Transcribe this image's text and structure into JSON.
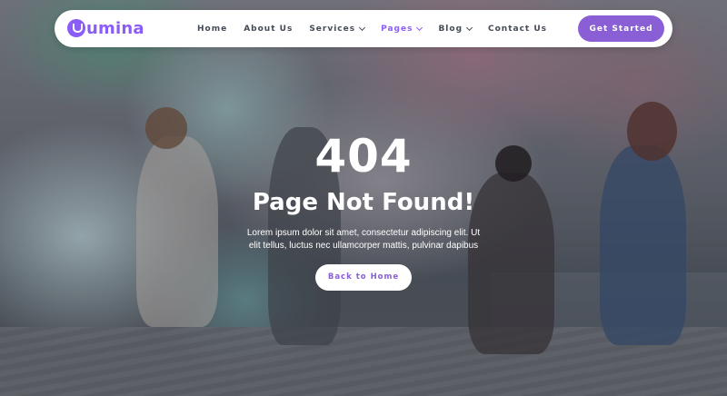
{
  "brand": {
    "name": "umina",
    "logo_letter": "L",
    "color": "#8b5cf6"
  },
  "nav": {
    "items": [
      {
        "label": "Home",
        "dropdown": false,
        "active": false
      },
      {
        "label": "About Us",
        "dropdown": false,
        "active": false
      },
      {
        "label": "Services",
        "dropdown": true,
        "active": false
      },
      {
        "label": "Pages",
        "dropdown": true,
        "active": true
      },
      {
        "label": "Blog",
        "dropdown": true,
        "active": false
      },
      {
        "label": "Contact Us",
        "dropdown": false,
        "active": false
      }
    ],
    "cta_label": "Get Started"
  },
  "error": {
    "code": "404",
    "title": "Page Not Found!",
    "description": "Lorem ipsum dolor sit amet, consectetur adipiscing elit. Ut elit tellus, luctus nec ullamcorper mattis, pulvinar dapibus",
    "button_label": "Back to Home"
  },
  "colors": {
    "accent": "#8a5fd6",
    "nav_text": "#444a56",
    "background_overlay": "#282837"
  }
}
